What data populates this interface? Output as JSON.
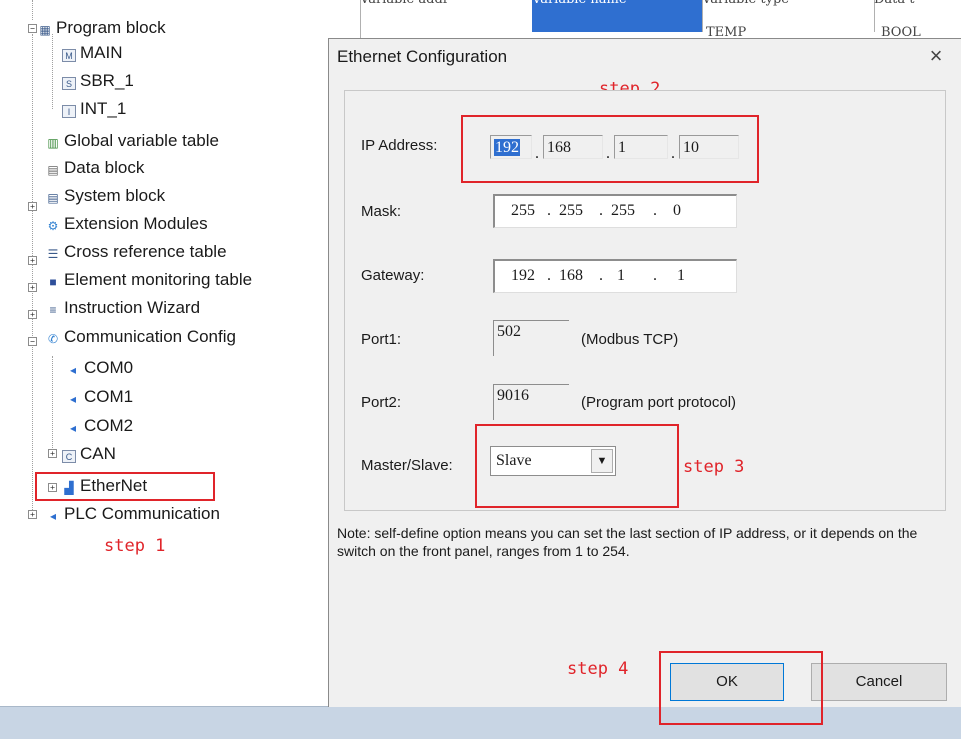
{
  "tree": {
    "items": [
      {
        "label": "Program block",
        "icon": "program-block-icon"
      },
      {
        "label": "MAIN",
        "icon": "main-routine-icon"
      },
      {
        "label": "SBR_1",
        "icon": "subroutine-icon"
      },
      {
        "label": "INT_1",
        "icon": "interrupt-icon"
      },
      {
        "label": "Global variable table",
        "icon": "table-icon"
      },
      {
        "label": "Data block",
        "icon": "data-block-icon"
      },
      {
        "label": "System block",
        "icon": "system-block-icon"
      },
      {
        "label": "Extension Modules",
        "icon": "gear-icon"
      },
      {
        "label": "Cross reference table",
        "icon": "cross-reference-icon"
      },
      {
        "label": "Element monitoring table",
        "icon": "monitor-icon"
      },
      {
        "label": "Instruction Wizard",
        "icon": "wizard-icon"
      },
      {
        "label": "Communication Config",
        "icon": "communication-icon"
      },
      {
        "label": "COM0",
        "icon": "port-icon"
      },
      {
        "label": "COM1",
        "icon": "port-icon"
      },
      {
        "label": "COM2",
        "icon": "port-icon"
      },
      {
        "label": "CAN",
        "icon": "can-icon"
      },
      {
        "label": "EtherNet",
        "icon": "ethernet-icon"
      },
      {
        "label": "PLC Communication",
        "icon": "port-icon"
      }
    ]
  },
  "background_grid": {
    "headers": [
      "Variable addr",
      "Variable name",
      "Variable type",
      "Data t"
    ],
    "row": [
      "",
      "",
      "TEMP",
      "BOOL"
    ]
  },
  "dialog": {
    "title": "Ethernet Configuration",
    "close_glyph": "×",
    "ip_label": "IP Address:",
    "ip": [
      "192",
      "168",
      "1",
      "10"
    ],
    "mask_label": "Mask:",
    "mask": [
      "255",
      "255",
      "255",
      "0"
    ],
    "gateway_label": "Gateway:",
    "gateway": [
      "192",
      "168",
      "1",
      "1"
    ],
    "port1_label": "Port1:",
    "port1_value": "502",
    "port1_desc": "(Modbus TCP)",
    "port2_label": "Port2:",
    "port2_value": "9016",
    "port2_desc": "(Program port protocol)",
    "master_slave_label": "Master/Slave:",
    "master_slave_value": "Slave",
    "note": "Note: self-define option means you can set the last section of IP address, or it depends on the switch on the front panel, ranges from 1 to 254.",
    "ok_label": "OK",
    "cancel_label": "Cancel"
  },
  "annotations": {
    "step1": "step 1",
    "step2": "step 2",
    "step3": "step 3",
    "step4": "step 4",
    "highlight_color": "#e0242a"
  }
}
